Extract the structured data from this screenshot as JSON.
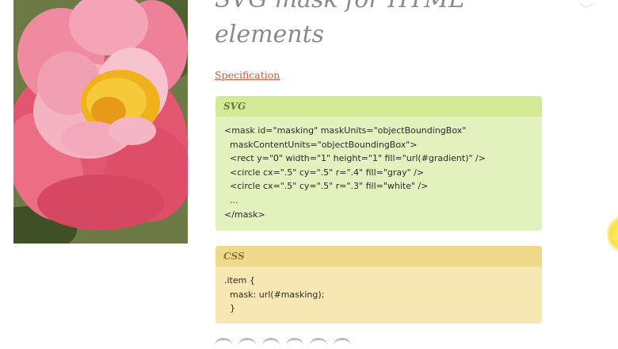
{
  "page": {
    "title_lines": "SVG mask for HTML\nelements",
    "spec_link_label": "Specification"
  },
  "panels": {
    "svg": {
      "header": "SVG",
      "code": "<mask id=\"masking\" maskUnits=\"objectBoundingBox\"\n  maskContentUnits=\"objectBoundingBox\">\n  <rect y=\"0\" width=\"1\" height=\"1\" fill=\"url(#gradient)\" />\n  <circle cx=\".5\" cy=\".5\" r=\".4\" fill=\"gray\" />\n  <circle cx=\".5\" cy=\".5\" r=\".3\" fill=\"white\" />\n  ...\n</mask>"
    },
    "css": {
      "header": "CSS",
      "code": ".item {\n  mask: url(#masking);\n  }"
    }
  },
  "colors": {
    "svg_panel_bg": "#e3f1bf",
    "svg_panel_header": "#d5ea97",
    "css_panel_bg": "#f7e7b3",
    "css_panel_header": "#efd98b",
    "link": "#d2553e"
  },
  "icons": {
    "cursor": "cursor-highlight-icon"
  }
}
